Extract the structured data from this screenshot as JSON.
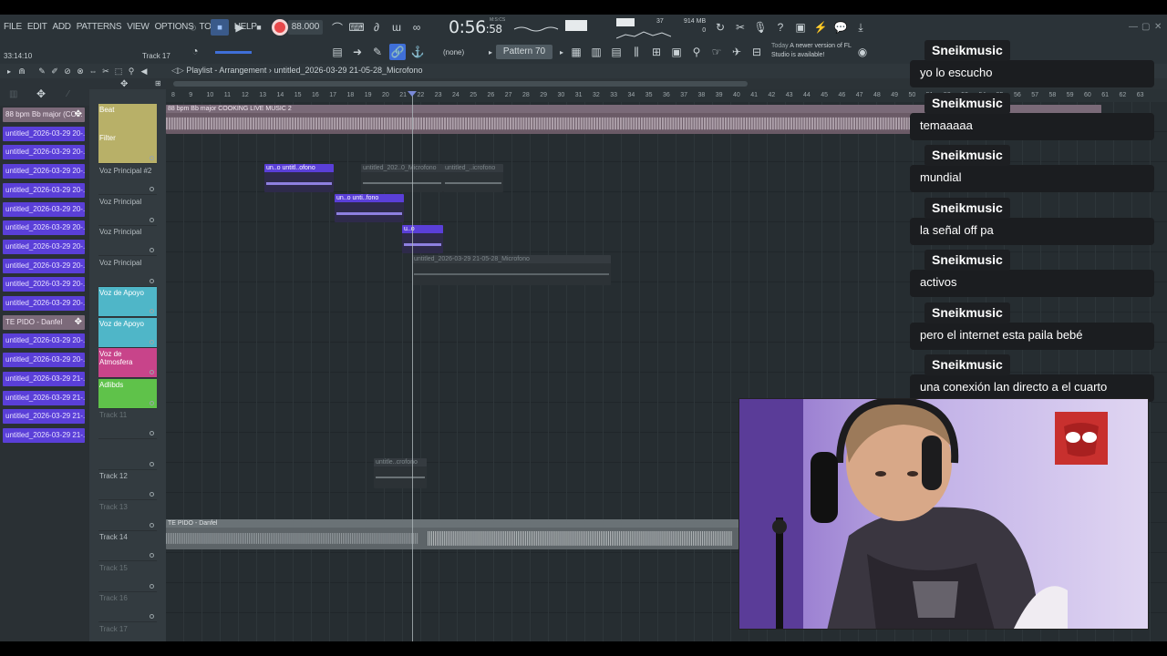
{
  "menu": [
    "FILE",
    "EDIT",
    "ADD",
    "PATTERNS",
    "VIEW",
    "OPTIONS",
    "TOOLS",
    "HELP"
  ],
  "transport": {
    "tempo": "88.000",
    "time": "0:56",
    "time_small": ":58",
    "time_unit_label": "M:S:CS",
    "song_time": "33:14:10",
    "track_label": "Track 17",
    "cpu": "37",
    "memory": "914 MB",
    "memory_sub": "0"
  },
  "pattern": {
    "label": "Pattern 70",
    "none_label": "(none)"
  },
  "notice": {
    "when": "Today",
    "text": "A newer version of FL Studio is available!"
  },
  "playlist": {
    "title": "Playlist - Arrangement",
    "separator": "›",
    "file": "untitled_2026-03-29 21-05-28_Microfono"
  },
  "picker": [
    {
      "label": "88 bpm Bb major (CO...",
      "kind": "audio"
    },
    {
      "label": "untitled_2026-03-29 20-...",
      "kind": "voice"
    },
    {
      "label": "untitled_2026-03-29 20-...",
      "kind": "voice"
    },
    {
      "label": "untitled_2026-03-29 20-...",
      "kind": "voice"
    },
    {
      "label": "untitled_2026-03-29 20-...",
      "kind": "voice"
    },
    {
      "label": "untitled_2026-03-29 20-...",
      "kind": "voice"
    },
    {
      "label": "untitled_2026-03-29 20-...",
      "kind": "voice"
    },
    {
      "label": "untitled_2026-03-29 20-...",
      "kind": "voice"
    },
    {
      "label": "untitled_2026-03-29 20-...",
      "kind": "voice"
    },
    {
      "label": "untitled_2026-03-29 20-...",
      "kind": "voice"
    },
    {
      "label": "untitled_2026-03-29 20-...",
      "kind": "voice"
    },
    {
      "label": "TE PIDO - Danfel",
      "kind": "audio"
    },
    {
      "label": "untitled_2026-03-29 20-...",
      "kind": "voice"
    },
    {
      "label": "untitled_2026-03-29 20-...",
      "kind": "voice"
    },
    {
      "label": "untitled_2026-03-29 21-...",
      "kind": "voice"
    },
    {
      "label": "untitled_2026-03-29 21-...",
      "kind": "voice"
    },
    {
      "label": "untitled_2026-03-29 21-...",
      "kind": "voice"
    },
    {
      "label": "untitled_2026-03-29 21-...",
      "kind": "voice"
    }
  ],
  "tracks": [
    {
      "name": "Beat",
      "sub": "Filter",
      "style": "beat"
    },
    {
      "name": "Voz Principal #2",
      "style": "normal"
    },
    {
      "name": "Voz Principal",
      "style": "normal"
    },
    {
      "name": "Voz Principal",
      "style": "normal"
    },
    {
      "name": "Voz Principal",
      "style": "normal"
    },
    {
      "name": "Voz de Apoyo",
      "style": "cyan"
    },
    {
      "name": "Voz de Apoyo",
      "style": "cyan"
    },
    {
      "name": "Voz de Atmosfera",
      "style": "magenta"
    },
    {
      "name": "Adlibds",
      "style": "green"
    },
    {
      "name": "Track 11",
      "style": "dim"
    },
    {
      "name": "",
      "style": "dim"
    },
    {
      "name": "Track 12",
      "style": "normal"
    },
    {
      "name": "Track 13",
      "style": "dim"
    },
    {
      "name": "Track 14",
      "style": "normal"
    },
    {
      "name": "Track 15",
      "style": "dim"
    },
    {
      "name": "Track 16",
      "style": "dim"
    },
    {
      "name": "Track 17",
      "style": "dim"
    }
  ],
  "ruler": [
    "8",
    "9",
    "10",
    "11",
    "12",
    "13",
    "14",
    "15",
    "16",
    "17",
    "18",
    "19",
    "20",
    "21",
    "22",
    "23",
    "24",
    "25",
    "26",
    "27",
    "28",
    "29",
    "30",
    "31",
    "32",
    "33",
    "34",
    "35",
    "36",
    "37",
    "38",
    "39",
    "40",
    "41",
    "42",
    "43",
    "44",
    "45",
    "46",
    "47",
    "48",
    "49",
    "50",
    "51",
    "52",
    "53",
    "54",
    "55",
    "56",
    "57",
    "58",
    "59",
    "60",
    "61",
    "62",
    "63"
  ],
  "clips": {
    "beat": "88 bpm Bb major COOKING LIVE MUSIC 2",
    "c1": "un..o  untitl..ofono",
    "c2": "untitled_202..0_Microfono",
    "c3": "untitled_..icrofono",
    "c4": "un..o  unti..fono",
    "c5": "u..o",
    "c6": "untitled_2026-03-29 21-05-28_Microfono",
    "c7": "untitle..crofono",
    "c8": "TE PIDO - Danfel"
  },
  "chat": [
    {
      "user": "Sneikmusic",
      "text": "yo lo escucho"
    },
    {
      "user": "Sneikmusic",
      "text": "temaaaaa"
    },
    {
      "user": "Sneikmusic",
      "text": "mundial"
    },
    {
      "user": "Sneikmusic",
      "text": "la señal off pa"
    },
    {
      "user": "Sneikmusic",
      "text": "activos"
    },
    {
      "user": "Sneikmusic",
      "text": "pero el internet esta paila bebé"
    },
    {
      "user": "Sneikmusic",
      "text": "una conexión lan directo a el cuarto"
    }
  ],
  "colors": {
    "accent_voice": "#5a3fd8",
    "beat_track": "#b8b068",
    "cyan_track": "#4fb6c8",
    "magenta_track": "#c8448a",
    "green_track": "#5fc24a",
    "record": "#e8484a"
  }
}
